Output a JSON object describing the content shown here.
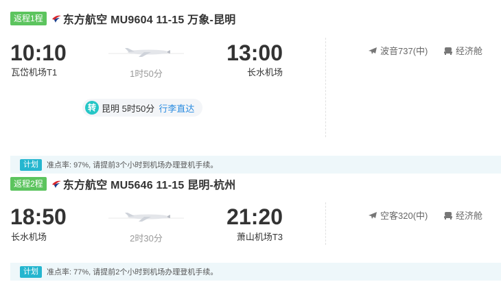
{
  "segments": [
    {
      "badge": "返程1程",
      "title": "东方航空 MU9604  11-15 万象-昆明",
      "dep_time": "10:10",
      "dep_airport": "瓦岱机场T1",
      "arr_time": "13:00",
      "arr_airport": "长水机场",
      "duration": "1时50分",
      "transfer": {
        "icon": "转",
        "text": "昆明 5时50分",
        "link": "行李直达"
      },
      "aircraft": "波音737(中)",
      "cabin": "经济舱",
      "note_tag": "计划",
      "note": "准点率: 97%, 请提前3个小时到机场办理登机手续。"
    },
    {
      "badge": "返程2程",
      "title": "东方航空 MU5646  11-15 昆明-杭州",
      "dep_time": "18:50",
      "dep_airport": "长水机场",
      "arr_time": "21:20",
      "arr_airport": "萧山机场T3",
      "duration": "2时30分",
      "aircraft": "空客320(中)",
      "cabin": "经济舱",
      "note_tag": "计划",
      "note": "准点率: 77%, 请提前2个小时到机场办理登机手续。"
    }
  ],
  "colors": {
    "badge_green": "#5cc45e",
    "transfer_teal": "#25c6c6",
    "link_blue": "#2a8ce0",
    "note_bg": "#eef7fa",
    "airline_red": "#d7262c"
  },
  "icons": [
    "china-eastern-logo-icon",
    "airplane-icon",
    "seat-icon",
    "transfer-icon"
  ]
}
